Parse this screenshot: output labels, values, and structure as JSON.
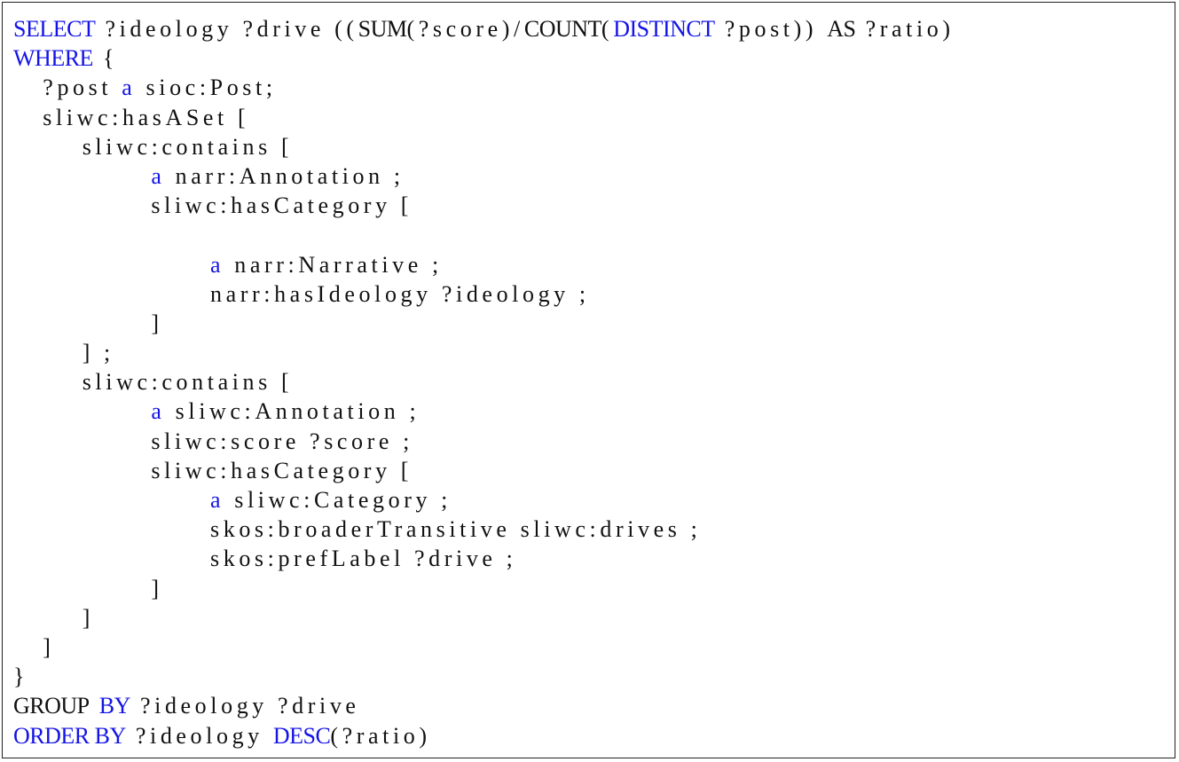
{
  "colors": {
    "keyword": "#1414e6",
    "text": "#111111"
  },
  "listing": [
    [
      [
        "kw",
        "SELECT"
      ],
      [
        "t",
        " ?ideology ?drive (("
      ],
      [
        "up",
        "SUM"
      ],
      [
        "t",
        "(?score)/"
      ],
      [
        "up",
        "COUNT"
      ],
      [
        "t",
        "("
      ],
      [
        "kw",
        "DISTINCT"
      ],
      [
        "t",
        " ?post)) "
      ],
      [
        "up",
        "AS"
      ],
      [
        "t",
        " ?ratio)"
      ]
    ],
    [
      [
        "kw",
        "WHERE"
      ],
      [
        "t",
        " {"
      ]
    ],
    [
      [
        "t",
        "   ?post "
      ],
      [
        "a",
        "a"
      ],
      [
        "t",
        " sioc:Post;"
      ]
    ],
    [
      [
        "t",
        "   sliwc:hasASet ["
      ]
    ],
    [
      [
        "t",
        "       sliwc:contains ["
      ]
    ],
    [
      [
        "t",
        "              "
      ],
      [
        "a",
        "a"
      ],
      [
        "t",
        " narr:Annotation ;"
      ]
    ],
    [
      [
        "t",
        "              sliwc:hasCategory ["
      ]
    ],
    [
      [
        "t",
        " "
      ]
    ],
    [
      [
        "t",
        "                    "
      ],
      [
        "a",
        "a"
      ],
      [
        "t",
        " narr:Narrative ;"
      ]
    ],
    [
      [
        "t",
        "                    narr:hasIdeology ?ideology ;"
      ]
    ],
    [
      [
        "t",
        "              ]"
      ]
    ],
    [
      [
        "t",
        "       ] ;"
      ]
    ],
    [
      [
        "t",
        "       sliwc:contains ["
      ]
    ],
    [
      [
        "t",
        "              "
      ],
      [
        "a",
        "a"
      ],
      [
        "t",
        " sliwc:Annotation ;"
      ]
    ],
    [
      [
        "t",
        "              sliwc:score ?score ;"
      ]
    ],
    [
      [
        "t",
        "              sliwc:hasCategory ["
      ]
    ],
    [
      [
        "t",
        "                    "
      ],
      [
        "a",
        "a"
      ],
      [
        "t",
        " sliwc:Category ;"
      ]
    ],
    [
      [
        "t",
        "                    skos:broaderTransitive sliwc:drives ;"
      ]
    ],
    [
      [
        "t",
        "                    skos:prefLabel ?drive ;"
      ]
    ],
    [
      [
        "t",
        "              ]"
      ]
    ],
    [
      [
        "t",
        "       ]"
      ]
    ],
    [
      [
        "t",
        "   ]"
      ]
    ],
    [
      [
        "t",
        "}"
      ]
    ],
    [
      [
        "up",
        "GROUP"
      ],
      [
        "t",
        " "
      ],
      [
        "kw",
        "BY"
      ],
      [
        "t",
        " ?ideology ?drive"
      ]
    ],
    [
      [
        "kw",
        "ORDER BY"
      ],
      [
        "t",
        " ?ideology "
      ],
      [
        "kw",
        "DESC"
      ],
      [
        "t",
        "(?ratio)"
      ]
    ]
  ]
}
